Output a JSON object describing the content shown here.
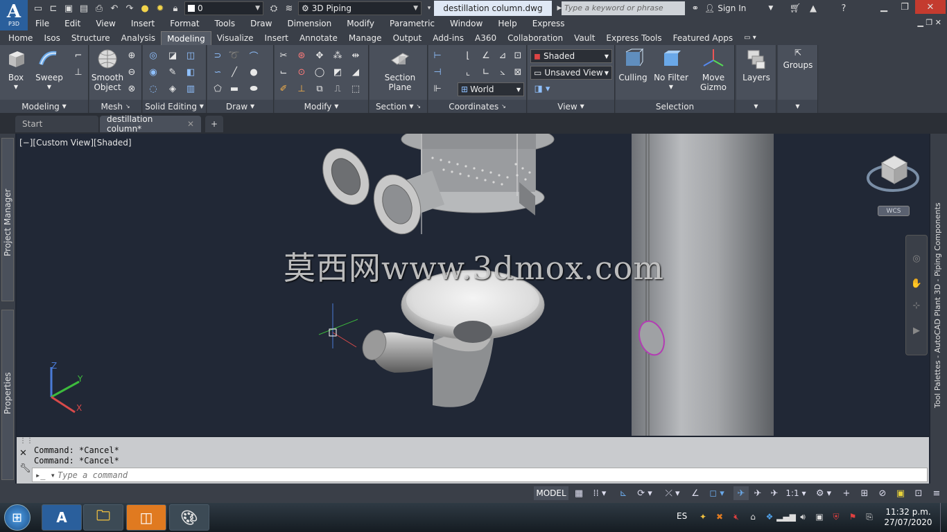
{
  "app": {
    "logo": "A",
    "logo_sub": "P3D"
  },
  "titlebar": {
    "layer_value": "0",
    "workspace": "3D Piping",
    "document_title": "destillation column.dwg",
    "search_placeholder": "Type a keyword or phrase",
    "sign_in": "Sign In"
  },
  "menubar": [
    "File",
    "Edit",
    "View",
    "Insert",
    "Format",
    "Tools",
    "Draw",
    "Dimension",
    "Modify",
    "Parametric",
    "Window",
    "Help",
    "Express"
  ],
  "ribbon_tabs": [
    "Home",
    "Isos",
    "Structure",
    "Analysis",
    "Modeling",
    "Visualize",
    "Insert",
    "Annotate",
    "Manage",
    "Output",
    "Add-ins",
    "A360",
    "Collaboration",
    "Vault",
    "Express Tools",
    "Featured Apps"
  ],
  "ribbon_active_tab": "Modeling",
  "ribbon": {
    "box": "Box",
    "sweep": "Sweep",
    "smooth_object_1": "Smooth",
    "smooth_object_2": "Object",
    "section_plane_1": "Section",
    "section_plane_2": "Plane",
    "visual_style": "Shaded",
    "named_view": "Unsaved View",
    "ucs": "World",
    "culling": "Culling",
    "no_filter": "No Filter",
    "move_gizmo_1": "Move",
    "move_gizmo_2": "Gizmo",
    "layers": "Layers",
    "groups": "Groups",
    "panels": {
      "modeling": "Modeling",
      "mesh": "Mesh",
      "solid_editing": "Solid Editing",
      "draw": "Draw",
      "modify": "Modify",
      "section": "Section",
      "coordinates": "Coordinates",
      "view": "View",
      "selection": "Selection"
    }
  },
  "file_tabs": {
    "start": "Start",
    "doc": "destillation column*"
  },
  "viewport": {
    "label": "[−][Custom View][Shaded]",
    "watermark": "莫西网www.3dmox.com",
    "viewcube_wcs": "WCS",
    "axis_x": "X",
    "axis_y": "Y",
    "axis_z": "Z"
  },
  "palettes": {
    "left_top": "Project Manager",
    "left_bottom": "Properties",
    "right": "Tool Palettes - AutoCAD Plant 3D - Piping Components"
  },
  "command": {
    "history": [
      "Command: *Cancel*",
      "Command: *Cancel*"
    ],
    "placeholder": "Type a command"
  },
  "statusbar": {
    "model": "MODEL",
    "scale": "1:1"
  },
  "taskbar": {
    "lang": "ES",
    "time": "11:32 p.m.",
    "date": "27/07/2020"
  },
  "colors": {
    "accent": "#2a5f9c",
    "viewport_bg": "#212836",
    "ribbon_bg": "#4a505b"
  }
}
